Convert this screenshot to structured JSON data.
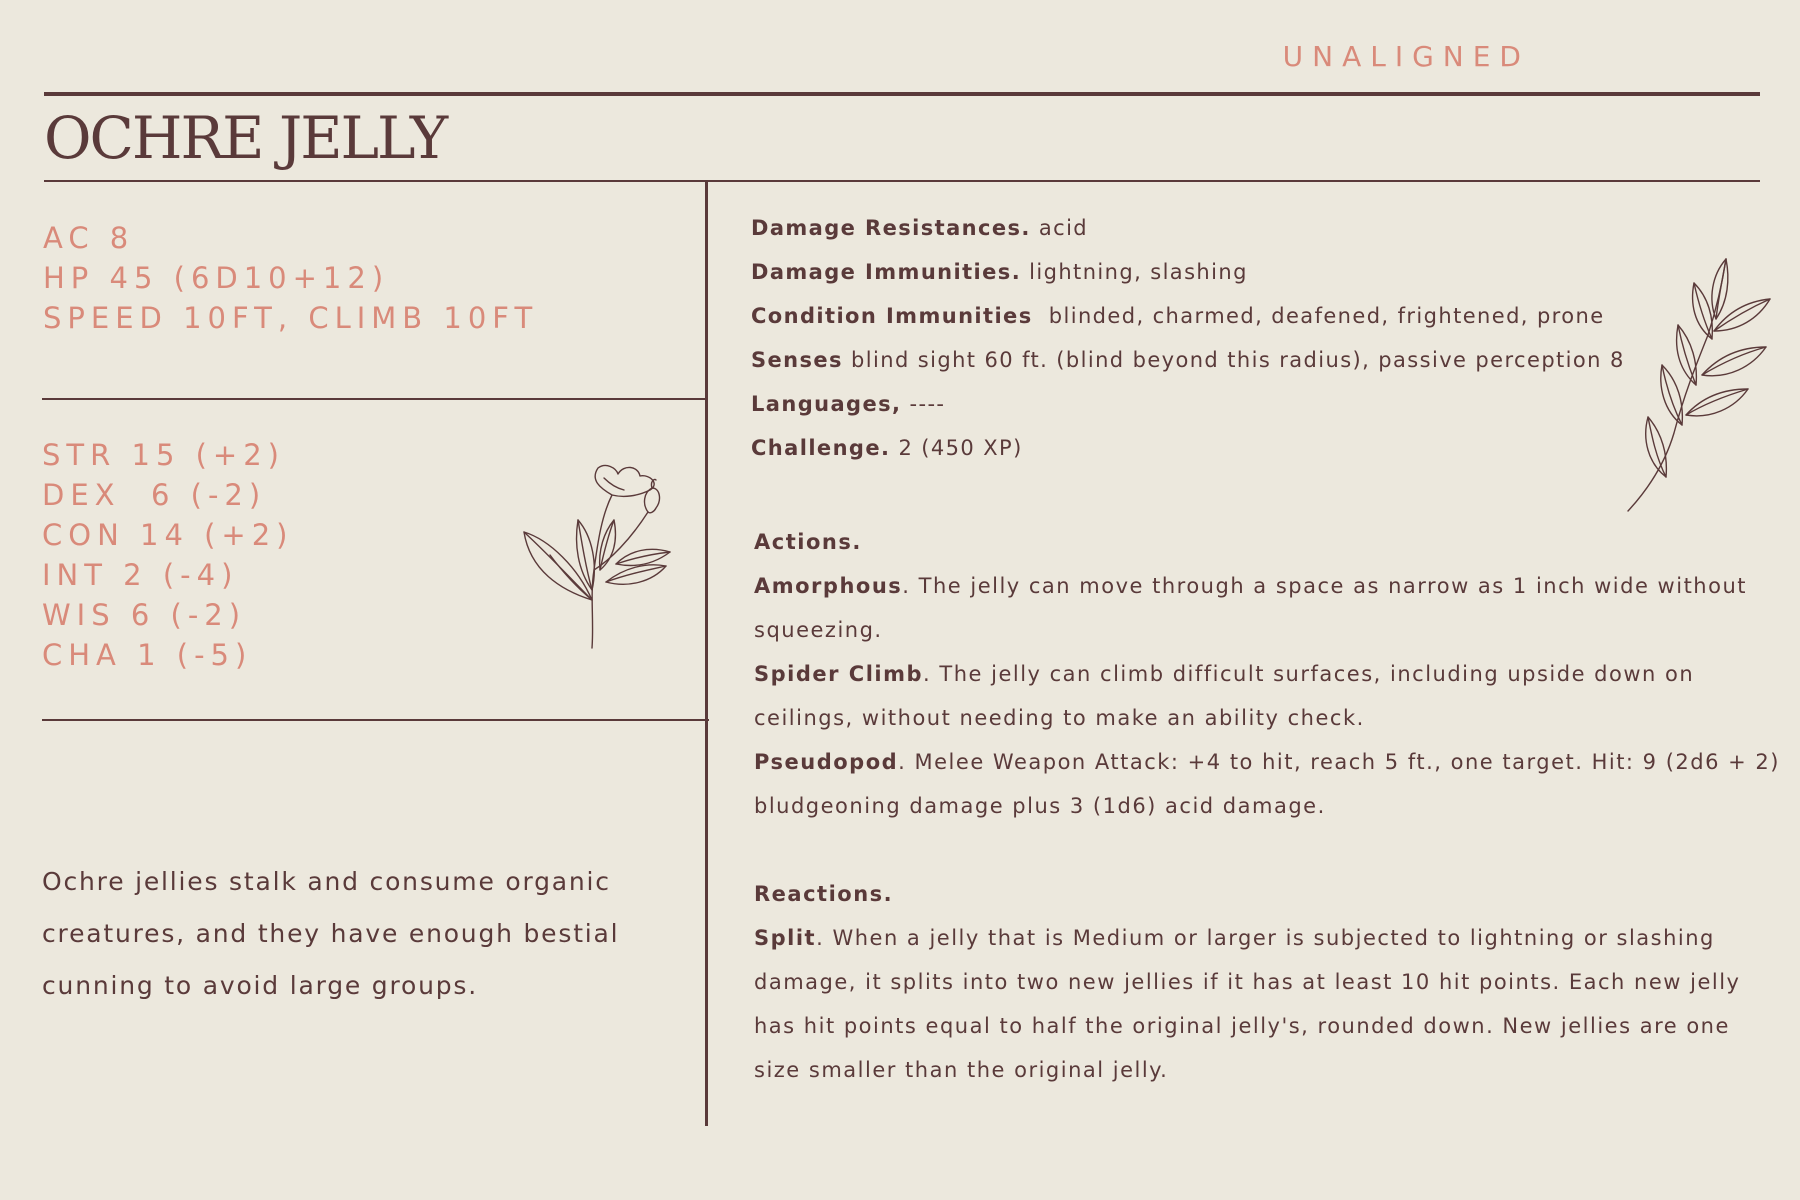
{
  "header": {
    "alignment": "UNALIGNED",
    "title": "OCHRE JELLY"
  },
  "core_stats": [
    "AC 8",
    "HP 45 (6D10+12)",
    "SPEED 10FT, CLIMB 10FT"
  ],
  "abilities": [
    "STR 15 (+2)",
    "DEX  6 (-2)",
    "CON 14 (+2)",
    "INT 2 (-4)",
    "WIS 6 (-2)",
    "CHA 1 (-5)"
  ],
  "description": "Ochre jellies stalk and consume organic creatures, and they have enough bestial cunning to avoid large groups.",
  "traits": [
    {
      "label": "Damage Resistances.",
      "value": " acid"
    },
    {
      "label": "Damage Immunities.",
      "value": " lightning, slashing"
    },
    {
      "label": "Condition Immunities",
      "value": "  blinded, charmed, deafened, frightened, prone"
    },
    {
      "label": "Senses",
      "value": " blind sight 60 ft. (blind beyond this radius), passive perception 8"
    },
    {
      "label": "Languages,",
      "value": " ----"
    },
    {
      "label": "Challenge.",
      "value": " 2 (450 XP)"
    }
  ],
  "actions": {
    "heading": "Actions.",
    "entries": [
      {
        "name": "Amorphous",
        "text": ". The jelly can move through a space as narrow as 1 inch wide without squeezing."
      },
      {
        "name": "Spider Climb",
        "text": ". The jelly can climb difficult surfaces, including upside down on ceilings, without needing to make an ability check."
      },
      {
        "name": "Pseudopod",
        "text": ". Melee Weapon Attack: +4 to hit, reach 5 ft., one target. Hit: 9 (2d6 + 2) bludgeoning damage plus 3 (1d6) acid damage."
      }
    ]
  },
  "reactions": {
    "heading": "Reactions.",
    "entries": [
      {
        "name": "Split",
        "text": ". When a jelly that is Medium or larger is subjected to lightning or slashing damage, it splits into two new jellies if it has at least 10 hit points. Each new jelly has hit points equal to half the original jelly's, rounded down. New jellies are one size smaller than the original jelly."
      }
    ]
  },
  "colors": {
    "background": "#ECE8DD",
    "ink": "#5A3A3A",
    "accent": "#D98A7A"
  },
  "icons": [
    "flower-illustration-icon",
    "leaf-branch-illustration-icon"
  ]
}
